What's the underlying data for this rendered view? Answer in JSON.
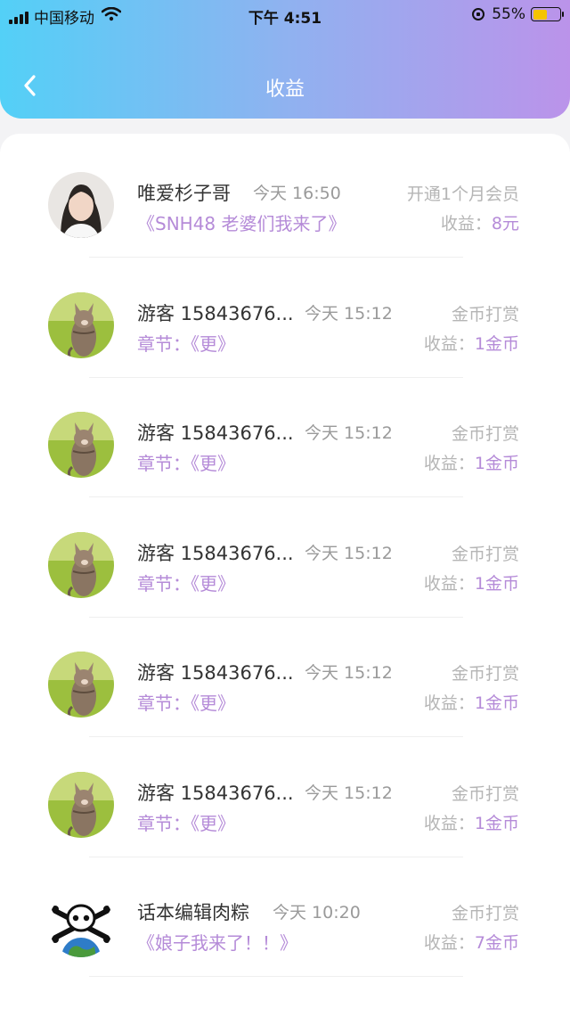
{
  "status_bar": {
    "carrier": "中国移动",
    "time": "下午 4:51",
    "battery": "55%"
  },
  "nav": {
    "title": "收益"
  },
  "records": [
    {
      "name": "唯爱杉子哥",
      "time": "今天 16:50",
      "type": "开通1个月会员",
      "detail": "《SNH48 老婆们我来了》",
      "earn_label": "收益：",
      "earn_value": "8元",
      "avatar": "girl"
    },
    {
      "name": "游客 15843676...",
      "time": "今天 15:12",
      "type": "金币打赏",
      "detail": "章节：《更》",
      "earn_label": "收益：",
      "earn_value": "1金币",
      "avatar": "kitten"
    },
    {
      "name": "游客 15843676...",
      "time": "今天 15:12",
      "type": "金币打赏",
      "detail": "章节：《更》",
      "earn_label": "收益：",
      "earn_value": "1金币",
      "avatar": "kitten"
    },
    {
      "name": "游客 15843676...",
      "time": "今天 15:12",
      "type": "金币打赏",
      "detail": "章节：《更》",
      "earn_label": "收益：",
      "earn_value": "1金币",
      "avatar": "kitten"
    },
    {
      "name": "游客 15843676...",
      "time": "今天 15:12",
      "type": "金币打赏",
      "detail": "章节：《更》",
      "earn_label": "收益：",
      "earn_value": "1金币",
      "avatar": "kitten"
    },
    {
      "name": "游客 15843676...",
      "time": "今天 15:12",
      "type": "金币打赏",
      "detail": "章节：《更》",
      "earn_label": "收益：",
      "earn_value": "1金币",
      "avatar": "kitten"
    },
    {
      "name": "话本编辑肉粽",
      "time": "今天 10:20",
      "type": "金币打赏",
      "detail": "《娘子我来了！！》",
      "earn_label": "收益：",
      "earn_value": "7金币",
      "avatar": "skull-globe"
    }
  ]
}
